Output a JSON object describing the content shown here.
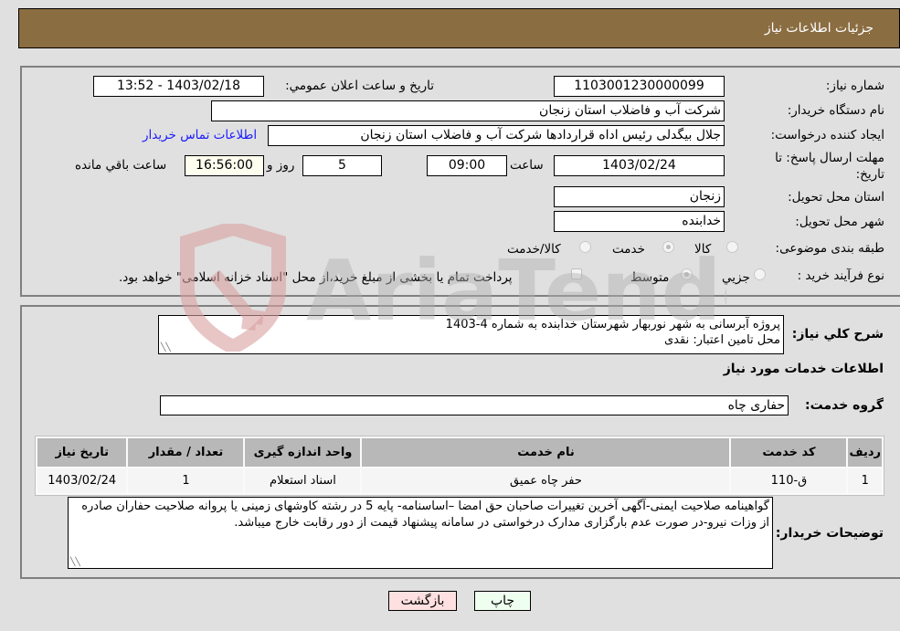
{
  "header": {
    "title": "جزئیات اطلاعات نیاز"
  },
  "fields": {
    "need_number": {
      "label": "شماره نیاز:",
      "value": "1103001230000099"
    },
    "announce_datetime": {
      "label": "تاریخ و ساعت اعلان عمومي:",
      "value": "1403/02/18 - 13:52"
    },
    "buyer_org": {
      "label": "نام دستگاه خریدار:",
      "value": "شرکت آب و فاضلاب استان زنجان"
    },
    "requester": {
      "label": "ایجاد کننده درخواست:",
      "value": "جلال بیگدلی رئیس اداه قراردادها شرکت آب و فاضلاب استان زنجان"
    },
    "contact_link": "اطلاعات تماس خریدار",
    "deadline": {
      "label": "مهلت ارسال پاسخ: تا تاریخ:",
      "date": "1403/02/24",
      "time_label": "ساعت",
      "time": "09:00",
      "days": "5",
      "days_label": "روز و",
      "remaining": "16:56:00",
      "remaining_label": "ساعت باقي مانده"
    },
    "province": {
      "label": "استان محل تحویل:",
      "value": "زنجان"
    },
    "city": {
      "label": "شهر محل تحویل:",
      "value": "خدابنده"
    },
    "category": {
      "label": "طبقه بندی موضوعی:",
      "options": [
        "کالا",
        "خدمت",
        "کالا/خدمت"
      ],
      "selected": "خدمت"
    },
    "purchase_type": {
      "label": "نوع فرآیند خرید :",
      "options": [
        "جزیي",
        "متوسط"
      ],
      "selected": "متوسط",
      "treasury_note": "پرداخت تمام یا بخشی از مبلغ خرید،از محل \"اسناد خزانه اسلامی\" خواهد بود."
    }
  },
  "description": {
    "label": "شرح کلي نیاز:",
    "line1": "پروژه آبرسانی به شهر نوربهار شهرستان خدابنده به شماره 4-1403",
    "line2": "محل تامین اعتبار: نقدی"
  },
  "services_section": {
    "title": "اطلاعات خدمات مورد نیاز",
    "group_label": "گروه خدمت:",
    "group_value": "حفاری چاه"
  },
  "table": {
    "headers": [
      "ردیف",
      "کد خدمت",
      "نام خدمت",
      "واحد اندازه گیری",
      "تعداد / مقدار",
      "تاریخ نیاز"
    ],
    "rows": [
      [
        "1",
        "ق-110",
        "حفر چاه عمیق",
        "اسناد استعلام",
        "1",
        "1403/02/24"
      ]
    ]
  },
  "buyer_notes": {
    "label": "توضیحات خریدار:",
    "text": "گواهینامه صلاحیت ایمنی-آگهی آخرین تغییرات صاحبان حق امضا –اساسنامه- پایه 5 در رشته کاوشهای زمینی یا پروانه صلاحیت حفاران صادره از وزات نیرو-در صورت عدم بارگزاری مدارک درخواستی در سامانه پیشنهاد قیمت از دور رقابت خارج میباشد."
  },
  "buttons": {
    "print": "چاپ",
    "back": "بازگشت"
  },
  "watermark": {
    "text": "AriaTender.neT"
  },
  "colors": {
    "header_bg": "#8b6d42",
    "print_bg": "#efffef",
    "back_bg": "#ffe0e0",
    "link": "#1a1aff"
  }
}
